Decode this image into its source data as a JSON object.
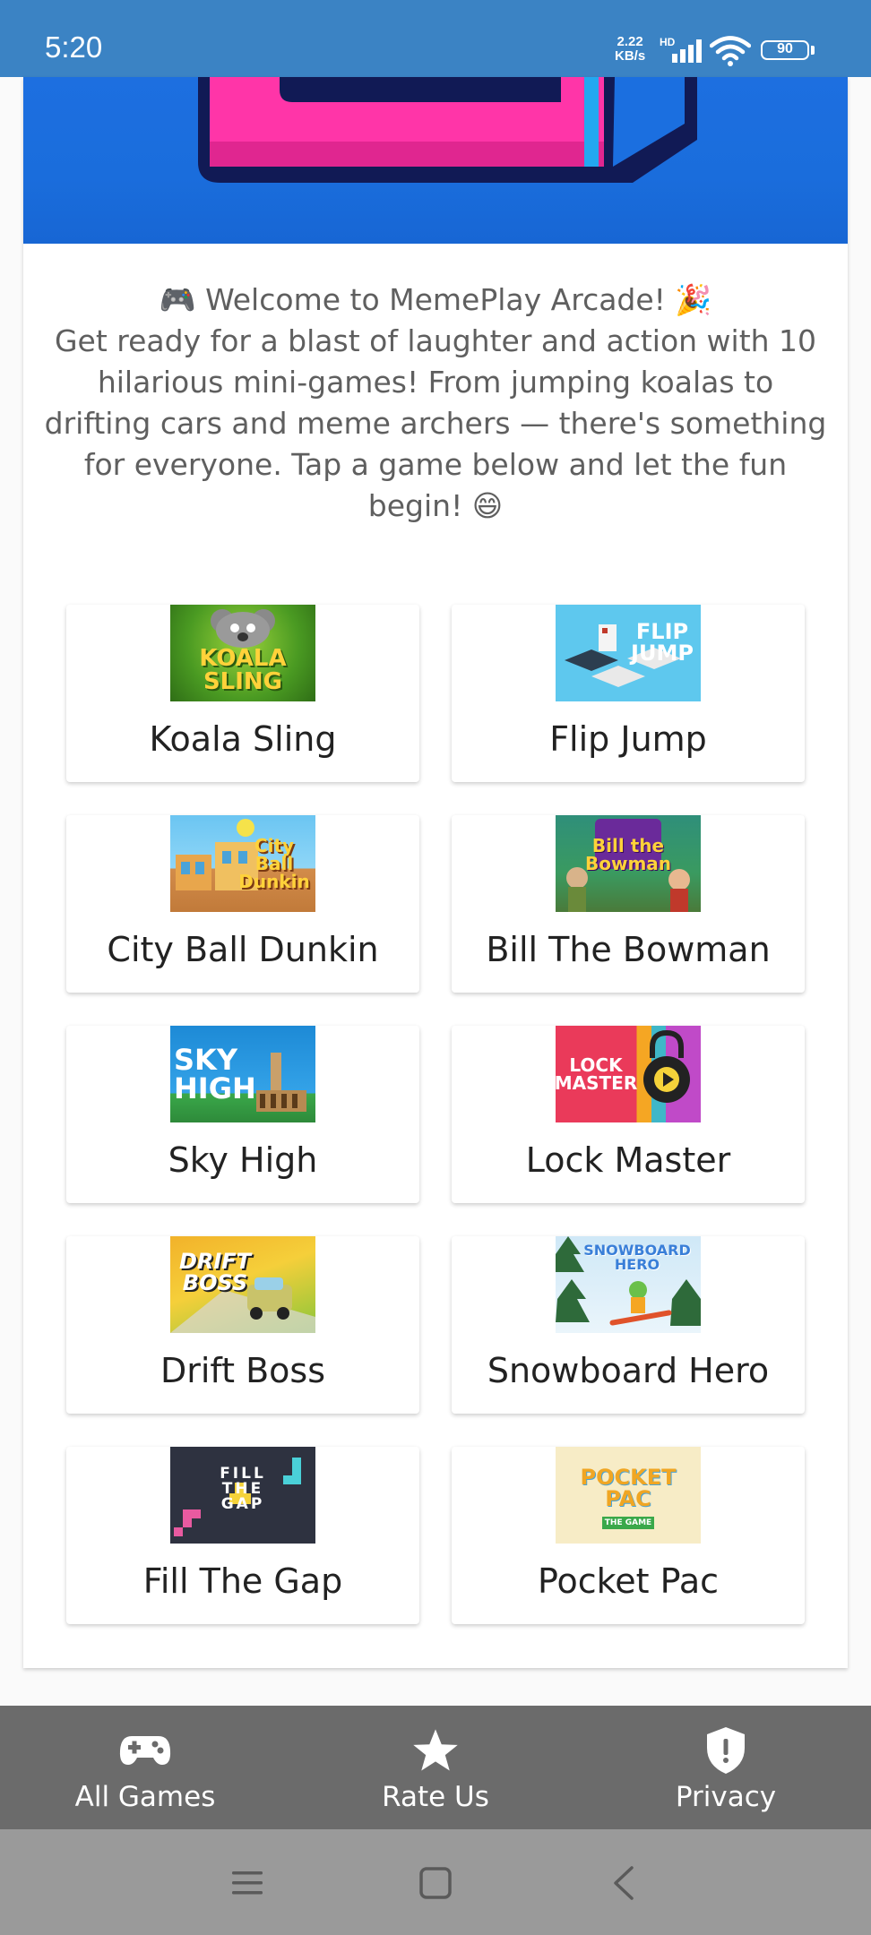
{
  "status_bar": {
    "time": "5:20",
    "net_speed_value": "2.22",
    "net_speed_unit": "KB/s",
    "hd_label": "HD",
    "battery_level": "90"
  },
  "welcome": {
    "headline": "🎮 Welcome to MemePlay Arcade! 🎉",
    "body": "Get ready for a blast of laughter and action with 10 hilarious mini-games! From jumping koalas to drifting cars and meme archers — there's something for everyone. Tap a game below and let the fun begin! 😄"
  },
  "games": [
    {
      "name": "Koala Sling",
      "thumb_text": "KOALA SLING"
    },
    {
      "name": "Flip Jump",
      "thumb_text": "FLIP JUMP"
    },
    {
      "name": "City Ball Dunkin",
      "thumb_text": "City Ball Dunkin"
    },
    {
      "name": "Bill The Bowman",
      "thumb_text": "Bill the Bowman"
    },
    {
      "name": "Sky High",
      "thumb_text": "SKY HIGH"
    },
    {
      "name": "Lock Master",
      "thumb_text": "LOCK MASTER"
    },
    {
      "name": "Drift Boss",
      "thumb_text": "DRIFT BOSS"
    },
    {
      "name": "Snowboard Hero",
      "thumb_text": "SNOWBOARD HERO"
    },
    {
      "name": "Fill The Gap",
      "thumb_text": "FILL THE GAP"
    },
    {
      "name": "Pocket Pac",
      "thumb_text": "POCKET PAC",
      "thumb_subtext": "THE GAME"
    }
  ],
  "bottom_nav": {
    "items": [
      {
        "label": "All Games",
        "icon": "gamepad-icon"
      },
      {
        "label": "Rate Us",
        "icon": "star-icon"
      },
      {
        "label": "Privacy",
        "icon": "shield-icon"
      }
    ]
  },
  "colors": {
    "status_bar": "#3b83c4",
    "hero_blue": "#1a6ddc",
    "bottom_nav": "#6b6b6b",
    "system_nav": "#9a9a9a",
    "text_muted": "#5f5f5f"
  }
}
